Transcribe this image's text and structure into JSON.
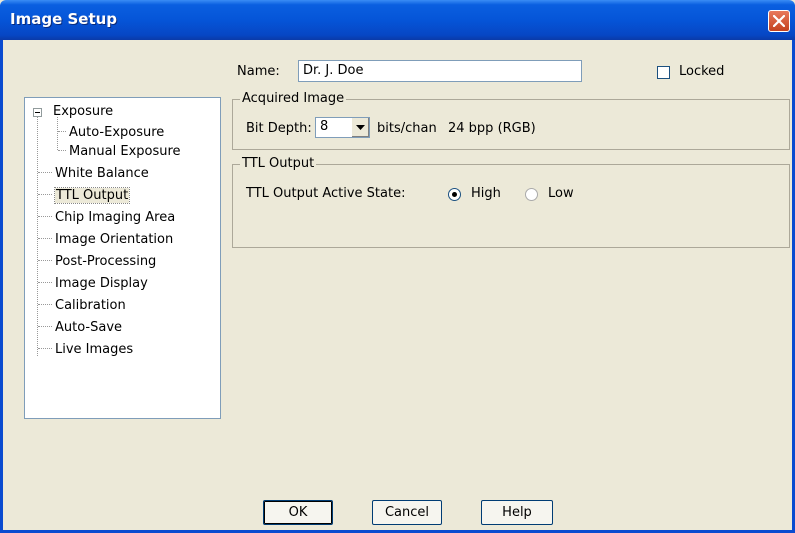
{
  "window": {
    "title": "Image Setup"
  },
  "tree": {
    "items": [
      {
        "label": "Exposure",
        "expanded": true
      },
      {
        "label": "Auto-Exposure"
      },
      {
        "label": "Manual Exposure"
      },
      {
        "label": "White Balance"
      },
      {
        "label": "TTL Output",
        "selected": true
      },
      {
        "label": "Chip Imaging Area"
      },
      {
        "label": "Image Orientation"
      },
      {
        "label": "Post-Processing"
      },
      {
        "label": "Image Display"
      },
      {
        "label": "Calibration"
      },
      {
        "label": "Auto-Save"
      },
      {
        "label": "Live Images"
      }
    ]
  },
  "name_field": {
    "label": "Name:",
    "value": "Dr. J. Doe"
  },
  "locked": {
    "label": "Locked",
    "checked": false
  },
  "acquired_image": {
    "title": "Acquired Image",
    "bit_depth_label": "Bit Depth:",
    "bit_depth_value": "8",
    "units": "bits/chan",
    "bpp": "24 bpp (RGB)"
  },
  "ttl_output": {
    "title": "TTL Output",
    "state_label": "TTL Output Active State:",
    "options": [
      {
        "label": "High",
        "selected": true
      },
      {
        "label": "Low",
        "selected": false
      }
    ]
  },
  "buttons": {
    "ok": "OK",
    "cancel": "Cancel",
    "help": "Help"
  }
}
